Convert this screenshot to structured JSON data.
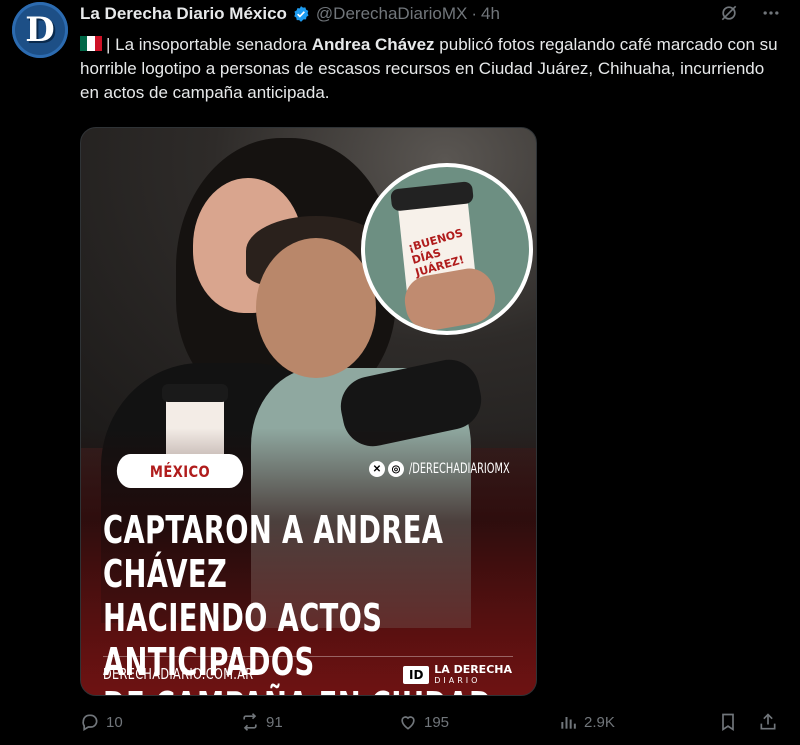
{
  "account": {
    "avatar_letter": "D",
    "display_name": "La Derecha Diario México",
    "handle": "@DerechaDiarioMX",
    "separator": "·",
    "timestamp": "4h"
  },
  "tweet": {
    "flag_colors": [
      "#006847",
      "#ffffff",
      "#ce1126"
    ],
    "text_part1": "| La insoportable senadora ",
    "text_bold": "Andrea Chávez",
    "text_part2": " publicó fotos regalando café marcado con su horrible logotipo a personas de escasos recursos en Ciudad Juárez, Chihuaha, incurriendo en actos de campaña anticipada."
  },
  "media": {
    "cup_text_line1": "¡BUENOS DÍAS",
    "cup_text_line2": "JUÁREZ!",
    "category_pill": "MÉXICO",
    "social_handle": "/DERECHADIARIOMX",
    "headline_line1": "CAPTARON A ANDREA CHÁVEZ",
    "headline_line2": "HACIENDO ACTOS ANTICIPADOS",
    "headline_line3": "DE CAMPAÑA EN CIUDAD JUÁREZ",
    "site": "DERECHADIARIO.COM.AR",
    "brand_logo": "ID",
    "brand_name": "LA DERECHA",
    "brand_sub": "DIARIO"
  },
  "actions": {
    "replies": "10",
    "reposts": "91",
    "likes": "195",
    "views": "2.9K"
  },
  "colors": {
    "background": "#000000",
    "text": "#e7e9ea",
    "muted": "#71767b",
    "verified": "#1d9bf0",
    "accent_red": "#b01c1c"
  }
}
